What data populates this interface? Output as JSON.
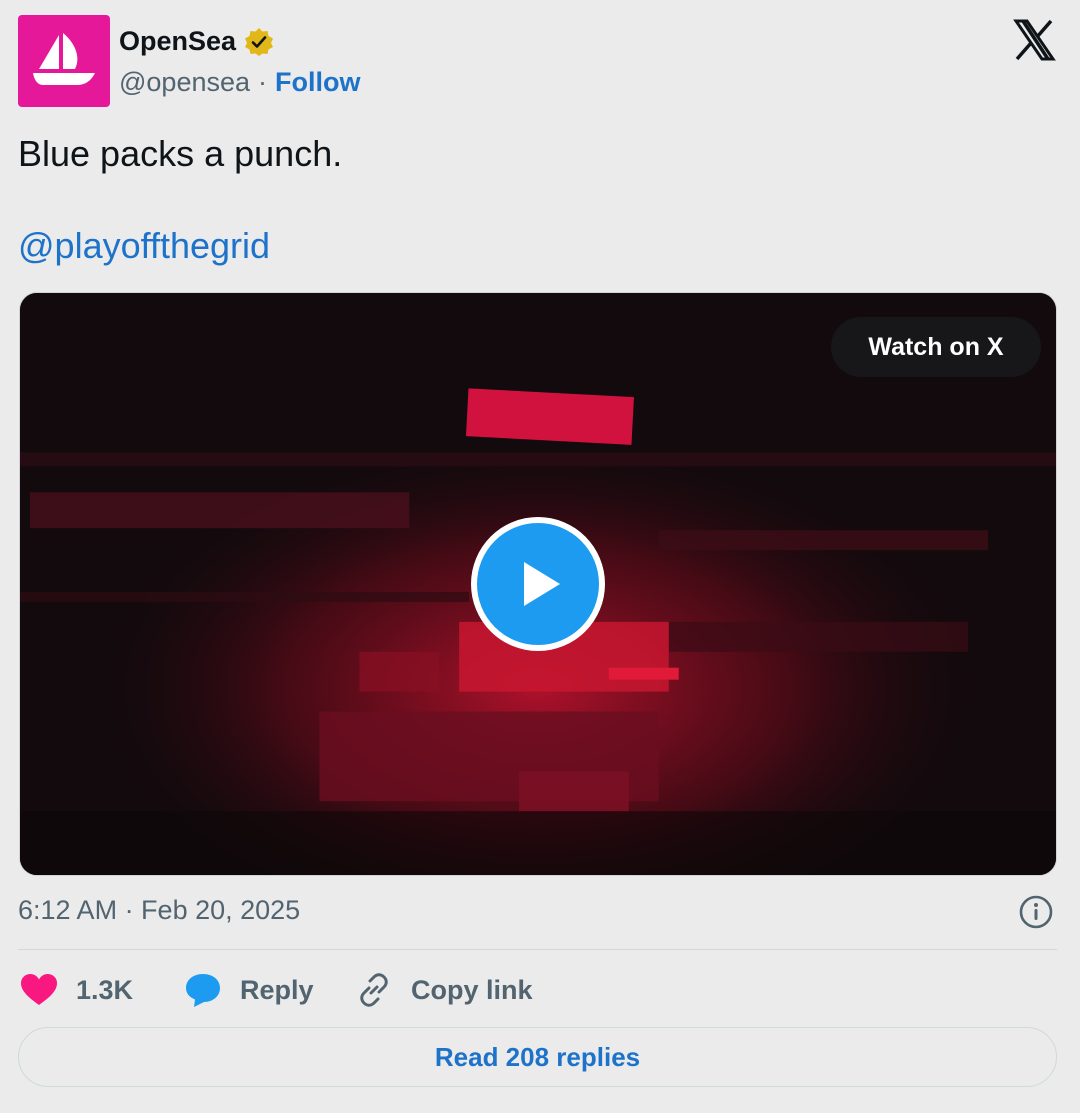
{
  "author": {
    "name": "OpenSea",
    "handle": "@opensea",
    "separator": "·",
    "follow_label": "Follow",
    "avatar_icon": "opensea-ship-icon",
    "avatar_color": "#e5189a",
    "verified_icon": "verified-gold-badge-icon"
  },
  "platform_logo": "x-logo-icon",
  "tweet": {
    "text": "Blue packs a punch.",
    "mention": "@playoffthegrid"
  },
  "media": {
    "watch_label": "Watch on X",
    "play_icon": "play-icon"
  },
  "meta": {
    "timestamp": "6:12 AM · Feb 20, 2025",
    "info_icon": "info-icon"
  },
  "actions": {
    "like_count": "1.3K",
    "reply_label": "Reply",
    "copy_label": "Copy link"
  },
  "footer": {
    "read_replies_label": "Read 208 replies"
  },
  "colors": {
    "link": "#1d72c9",
    "play": "#1d9bf0",
    "like": "#f91880",
    "reply": "#1d9bf0"
  }
}
